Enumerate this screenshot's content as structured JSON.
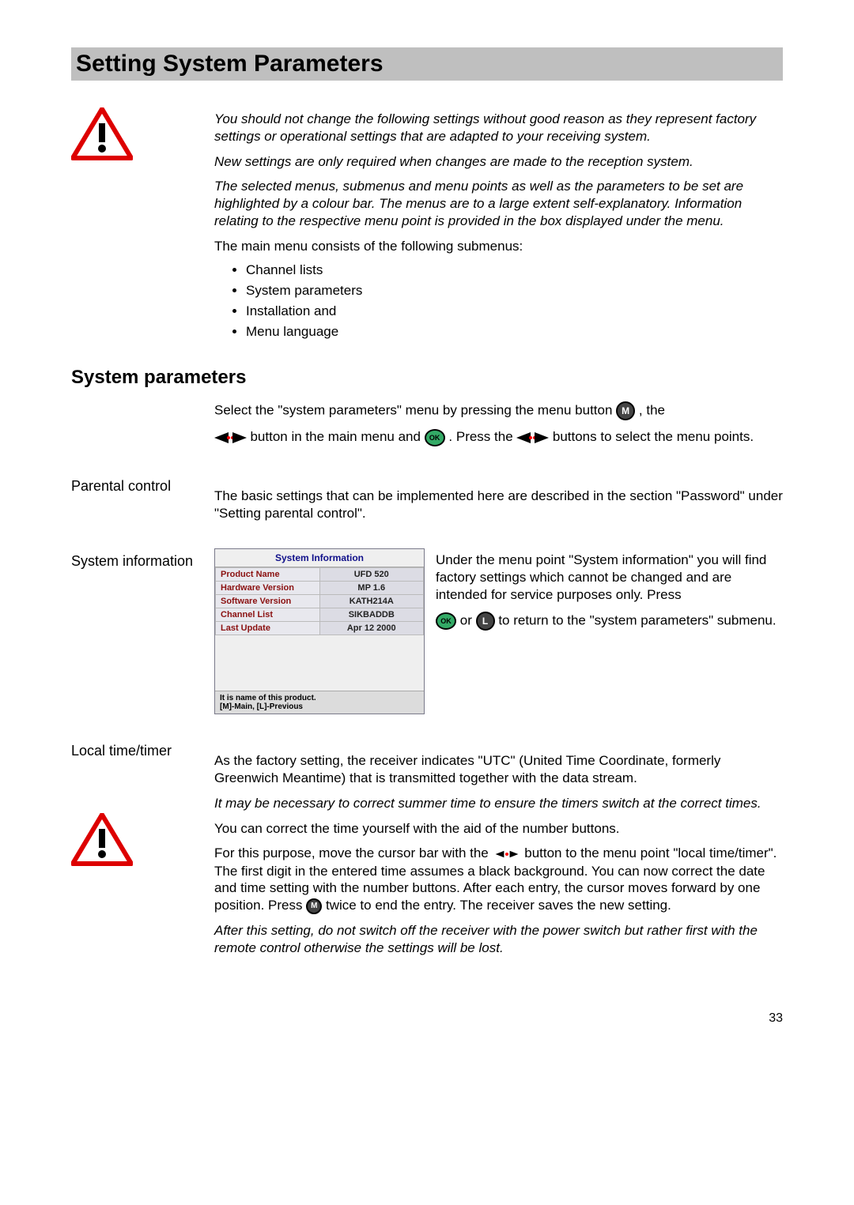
{
  "title": "Setting System Parameters",
  "intro": {
    "warn1": "You should not change the following settings without good reason as they represent factory settings or operational settings that are adapted to your receiving system.",
    "warn2": "New settings are only required when changes are made to the reception system.",
    "warn3": "The selected menus, submenus and menu points as well as the parameters to be set are highlighted by a colour bar. The menus are to a large extent self-explanatory. Information relating to the respective menu point is provided in the box displayed under the menu.",
    "lead": "The main menu consists of the following submenus:",
    "bullets": [
      "Channel lists",
      "System parameters",
      "Installation and",
      "Menu language"
    ]
  },
  "sysparams_heading": "System parameters",
  "sysparams": {
    "p1a": "Select the \"system parameters\" menu by pressing the menu button ",
    "p1b": ", the",
    "p2a": " button in the main menu and ",
    "p2b": ". Press the ",
    "p2c": " buttons to select the menu points."
  },
  "parental": {
    "heading": "Parental control",
    "p": "The basic settings that can be implemented here are described in the section \"Password\" under \"Setting parental control\"."
  },
  "sysinfo": {
    "heading": "System information",
    "box_title": "System Information",
    "rows": [
      {
        "k": "Product Name",
        "v": "UFD 520"
      },
      {
        "k": "Hardware Version",
        "v": "MP 1.6"
      },
      {
        "k": "Software Version",
        "v": "KATH214A"
      },
      {
        "k": "Channel List",
        "v": "SIKBADDB"
      },
      {
        "k": "Last Update",
        "v": "Apr 12 2000"
      }
    ],
    "footer1": "It is name of this product.",
    "footer2": "[M]-Main, [L]-Previous",
    "text1": "Under the menu point \"System information\" you will find factory settings which cannot be changed and are intended for service purposes only. Press",
    "text2a": " or ",
    "text2b": " to return to the \"system parameters\" submenu."
  },
  "localtime": {
    "heading": "Local time/timer",
    "p1": "As the factory setting, the receiver indicates \"UTC\" (United Time Coordinate, formerly Greenwich Meantime) that is transmitted together with the data stream.",
    "p2": "It may be necessary to correct summer time to ensure the timers switch at the correct times.",
    "p3": "You can correct the time yourself with the aid of the number buttons.",
    "p4a": "For this purpose, move the cursor bar with the ",
    "p4b": " button to the menu point \"local time/timer\". The first digit in the entered time assumes a black background. You can now correct the date and time setting with the number buttons. After each entry, the cursor moves forward by one position. Press ",
    "p4c": " twice to end the entry. The receiver saves the new setting.",
    "p5": "After this setting, do not switch off the receiver with the power switch but rather first with the remote control otherwise the settings will be lost."
  },
  "page_number": "33",
  "chart_data": {
    "type": "table",
    "title": "System Information",
    "rows": [
      [
        "Product Name",
        "UFD 520"
      ],
      [
        "Hardware Version",
        "MP 1.6"
      ],
      [
        "Software Version",
        "KATH214A"
      ],
      [
        "Channel List",
        "SIKBADDB"
      ],
      [
        "Last Update",
        "Apr 12 2000"
      ]
    ]
  }
}
